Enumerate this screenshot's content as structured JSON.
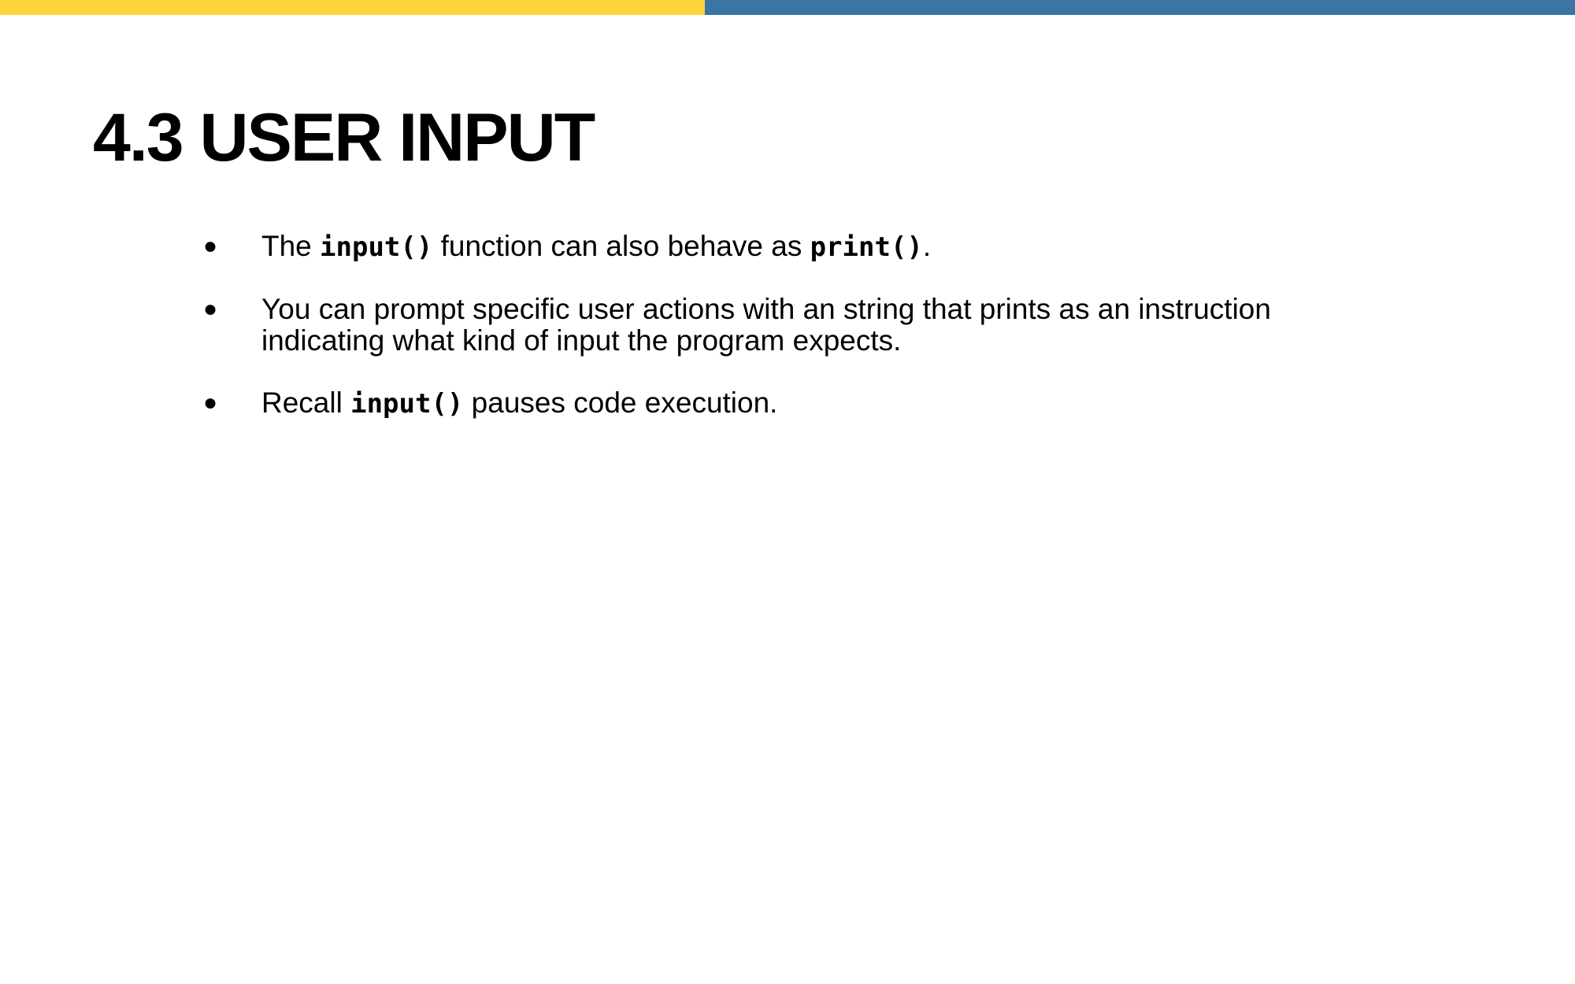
{
  "slide": {
    "title": "4.3 USER INPUT",
    "accent_colors": {
      "left_bar": "#ffd43b",
      "right_bar": "#3a75a6"
    },
    "bullets": [
      {
        "text_1": "The ",
        "code_1": "input()",
        "text_2": " function can also behave as ",
        "code_2": "print()",
        "text_3": "."
      },
      {
        "text_1": "You can prompt specific user actions with an string that prints as an instruction indicating what kind of input the program expects."
      },
      {
        "text_1": "Recall ",
        "code_1": "input()",
        "text_2": " pauses code execution."
      }
    ],
    "bullet_glyph": "●"
  }
}
